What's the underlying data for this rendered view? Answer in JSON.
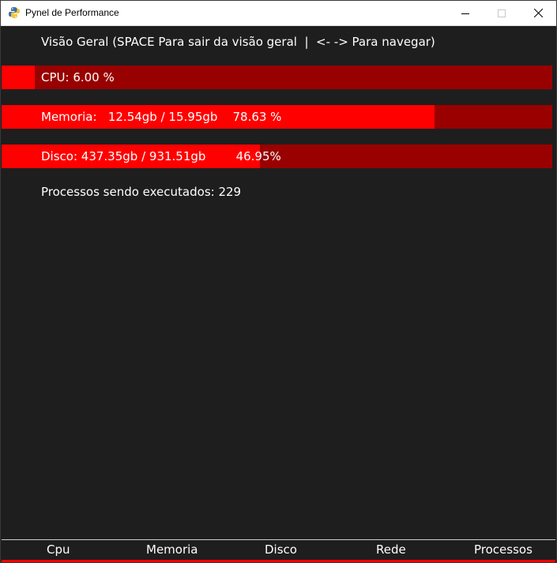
{
  "window": {
    "title": "Pynel de Performance",
    "icon": "python-snake-icon",
    "controls": [
      "minimize-icon",
      "maximize-icon",
      "close-icon"
    ]
  },
  "header": {
    "text": "Visão Geral (SPACE Para sair da visão geral  |  <- -> Para navegar)"
  },
  "colors": {
    "background": "#1e1e1e",
    "bar_fill": "#ff0000",
    "bar_track": "#990000",
    "text": "#ffffff"
  },
  "metrics": {
    "cpu": {
      "label": "CPU: 6.00 %",
      "percent": 6.0
    },
    "memory": {
      "label": "Memoria:   12.54gb / 15.95gb    78.63 %",
      "percent": 78.63
    },
    "disk": {
      "label": "Disco: 437.35gb / 931.51gb        46.95%",
      "percent": 46.95
    }
  },
  "processes": {
    "text": "Processos sendo executados: 229"
  },
  "tabs": [
    {
      "label": "Cpu"
    },
    {
      "label": "Memoria"
    },
    {
      "label": "Disco"
    },
    {
      "label": "Rede"
    },
    {
      "label": "Processos"
    }
  ]
}
